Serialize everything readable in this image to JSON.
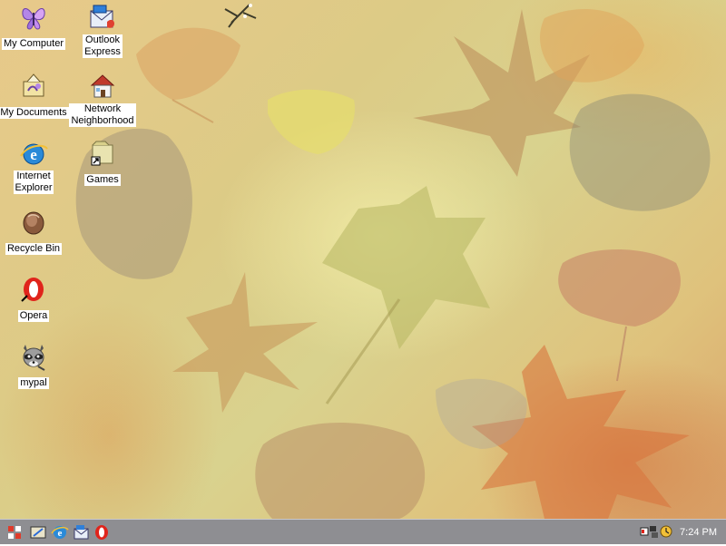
{
  "desktop": {
    "icons": [
      {
        "id": "my-computer",
        "label": "My Computer",
        "icon": "butterfly-icon"
      },
      {
        "id": "outlook-express",
        "label": "Outlook\nExpress",
        "icon": "outlook-express-icon"
      },
      {
        "id": "my-documents",
        "label": "My Documents",
        "icon": "my-documents-icon"
      },
      {
        "id": "network-neighborhood",
        "label": "Network\nNeighborhood",
        "icon": "network-house-icon"
      },
      {
        "id": "internet-explorer",
        "label": "Internet\nExplorer",
        "icon": "internet-explorer-icon"
      },
      {
        "id": "games",
        "label": "Games",
        "icon": "games-shortcut-icon"
      },
      {
        "id": "recycle-bin",
        "label": "Recycle Bin",
        "icon": "recycle-bin-icon"
      },
      {
        "id": "opera",
        "label": "Opera",
        "icon": "opera-icon"
      },
      {
        "id": "mypal",
        "label": "mypal",
        "icon": "mypal-raccoon-icon"
      }
    ]
  },
  "taskbar": {
    "start_icon": "start-logo-icon",
    "quick_launch": [
      {
        "id": "show-desktop",
        "icon": "show-desktop-icon"
      },
      {
        "id": "ie-launch",
        "icon": "internet-explorer-icon"
      },
      {
        "id": "outlook-launch",
        "icon": "outlook-express-icon"
      },
      {
        "id": "opera-launch",
        "icon": "opera-icon"
      }
    ],
    "tray_icons": [
      "speaker-icon",
      "network-status-icon",
      "scheduler-icon"
    ],
    "clock": "7:24 PM"
  },
  "colors": {
    "taskbar": "#8e8e92",
    "label_bg": "#ffffff",
    "clock_text": "#ffffff"
  }
}
